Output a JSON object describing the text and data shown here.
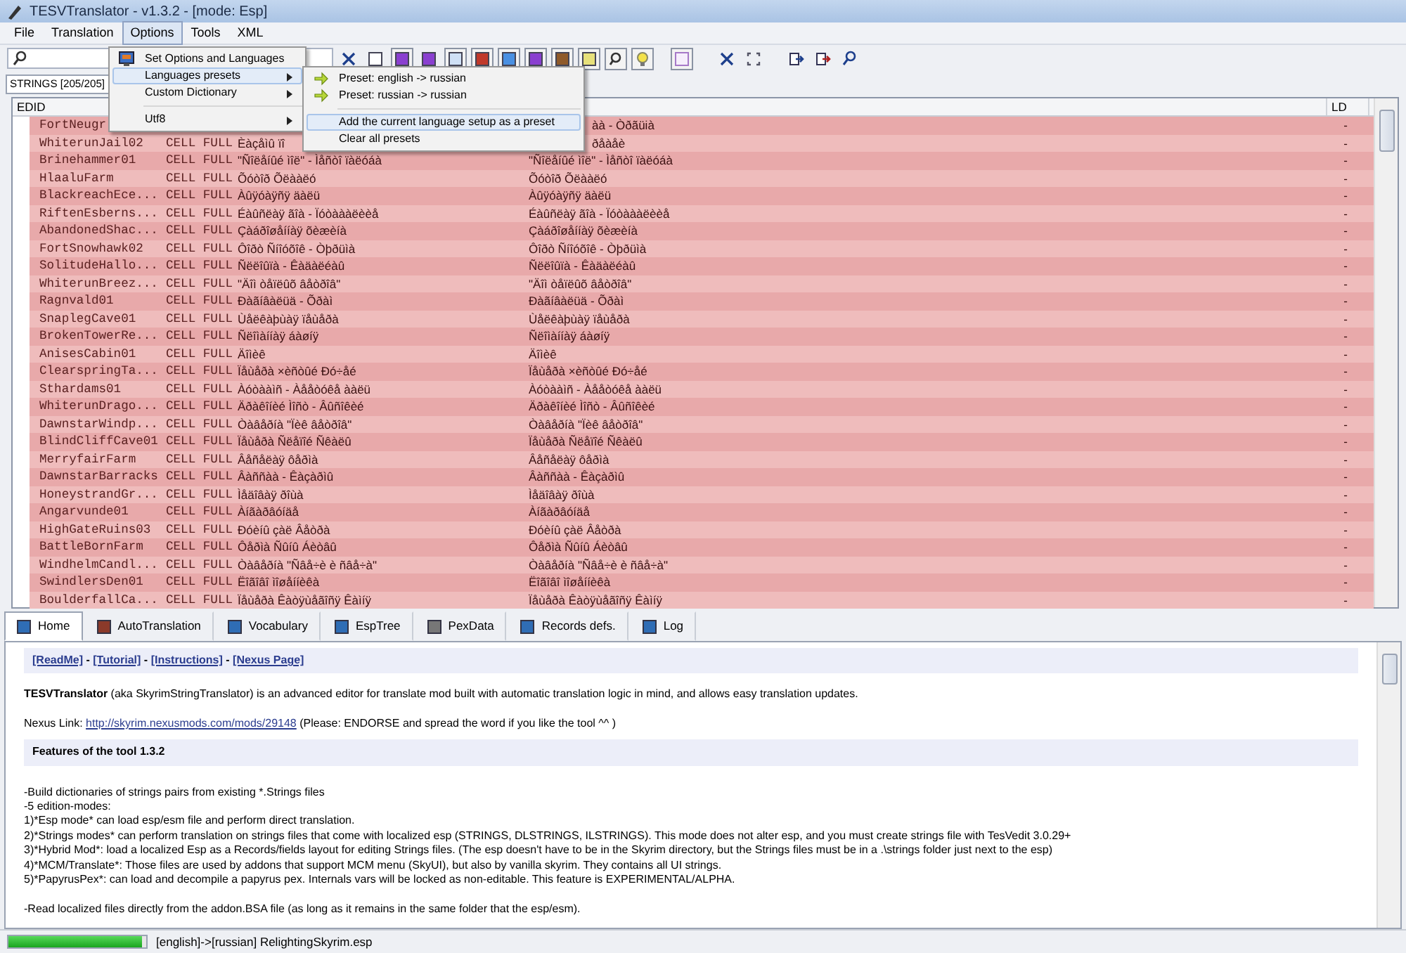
{
  "window": {
    "title": "TESVTranslator - v1.3.2 - [mode: Esp]"
  },
  "menu_bar": [
    {
      "label": "File",
      "selected": false
    },
    {
      "label": "Translation",
      "selected": false
    },
    {
      "label": "Options",
      "selected": true
    },
    {
      "label": "Tools",
      "selected": false
    },
    {
      "label": "XML",
      "selected": false
    }
  ],
  "options_menu": [
    {
      "label": "Set Options and Languages",
      "selected": false,
      "submenu": false
    },
    {
      "label": "Languages presets",
      "selected": true,
      "submenu": true
    },
    {
      "label": "Custom Dictionary",
      "selected": false,
      "submenu": true
    },
    {
      "label": "Utf8",
      "selected": false,
      "submenu": true
    }
  ],
  "presets_menu": [
    {
      "label": "Preset: english -> russian",
      "selected": false,
      "kind": "preset"
    },
    {
      "label": "Preset: russian -> russian",
      "selected": false,
      "kind": "preset"
    },
    {
      "label": "Add the current language setup as a preset",
      "selected": true,
      "kind": "action"
    },
    {
      "label": "Clear all presets",
      "selected": false,
      "kind": "action"
    }
  ],
  "strings_label": "STRINGS [205/205]",
  "table": {
    "columns": [
      "EDID",
      "LD"
    ],
    "rows": [
      {
        "kind": "covered",
        "edid": "FortNeugr",
        "dest": "àà - Òðãüià",
        "ld": "-"
      },
      {
        "kind": "covered",
        "edid": "WhiterunJail02",
        "type": "CELL FULL",
        "source": "Èàçåìû ïî",
        "dest": "ðåàåè",
        "ld": "-"
      },
      {
        "kind": "full",
        "edid": "Brinehammer01",
        "type": "CELL FULL",
        "source": "\"Ñîëåíûé ìîë\" - Ìåñòî ïàëóáà",
        "dest": "\"Ñîëåíûé ìîë\" - Ìåñòî ïàëóáà",
        "ld": "-"
      },
      {
        "kind": "full",
        "edid": "HlaaluFarm",
        "type": "CELL FULL",
        "source": "Õóòîð Õëààëó",
        "dest": "Õóòîð Õëààëó",
        "ld": "-"
      },
      {
        "kind": "full",
        "edid": "BlackreachEce...",
        "type": "CELL FULL",
        "source": "Àûÿóàÿñÿ äàëü",
        "dest": "Àûÿóàÿñÿ äàëü",
        "ld": "-"
      },
      {
        "kind": "full",
        "edid": "RiftenEsberns...",
        "type": "CELL FULL",
        "source": "Éàûñëàÿ ãîà - Ïóòàààëèèå",
        "dest": "Éàûñëàÿ ãîà - Ïóòàààëèèå",
        "ld": "-"
      },
      {
        "kind": "full",
        "edid": "AbandonedShac...",
        "type": "CELL FULL",
        "source": "Çàáðîøåííàÿ õèæèíà",
        "dest": "Çàáðîøåííàÿ õèæèíà",
        "ld": "-"
      },
      {
        "kind": "full",
        "edid": "FortSnowhawk02",
        "type": "CELL FULL",
        "source": "Ôîðò Ñíîóõîê - Òþðüìà",
        "dest": "Ôîðò Ñíîóõîê - Òþðüìà",
        "ld": "-"
      },
      {
        "kind": "full",
        "edid": "SolitudeHallo...",
        "type": "CELL FULL",
        "source": "Ñëëîûïà - Êàäàëéàû",
        "dest": "Ñëëîûïà - Êàäàëéàû",
        "ld": "-"
      },
      {
        "kind": "full",
        "edid": "WhiterunBreez...",
        "type": "CELL FULL",
        "source": "\"Äîì òåïëûõ âåòðîâ\"",
        "dest": "\"Äîì òåïëûõ âåòðîâ\"",
        "ld": "-"
      },
      {
        "kind": "full",
        "edid": "Ragnvald01",
        "type": "CELL FULL",
        "source": "Ðàãíâàëüä - Õðàì",
        "dest": "Ðàãíâàëüä - Õðàì",
        "ld": "-"
      },
      {
        "kind": "full",
        "edid": "SnaplegCave01",
        "type": "CELL FULL",
        "source": "Ùåëêàþùàÿ ïåùåðà",
        "dest": "Ùåëêàþùàÿ ïåùåðà",
        "ld": "-"
      },
      {
        "kind": "full",
        "edid": "BrokenTowerRe...",
        "type": "CELL FULL",
        "source": "Ñëîìàííàÿ áàøíÿ",
        "dest": "Ñëîìàííàÿ áàøíÿ",
        "ld": "-"
      },
      {
        "kind": "full",
        "edid": "AnisesCabin01",
        "type": "CELL FULL",
        "source": "Äîìèê",
        "dest": "Äîìèê",
        "ld": "-"
      },
      {
        "kind": "full",
        "edid": "ClearspringTa...",
        "type": "CELL FULL",
        "source": "Ïåùåðà ×èñòûé Ðó÷åé",
        "dest": "Ïåùåðà ×èñòûé Ðó÷åé",
        "ld": "-"
      },
      {
        "kind": "full",
        "edid": "Sthardams01",
        "type": "CELL FULL",
        "source": "Àóòààìñ - Àååòóêå ààëü",
        "dest": "Àóòààìñ - Àååòóêå ààëü",
        "ld": "-"
      },
      {
        "kind": "full",
        "edid": "WhiterunDrago...",
        "type": "CELL FULL",
        "source": "Äðàêîíèé Ìîñò - Âûñîêèé",
        "dest": "Äðàêîíèé Ìîñò - Âûñîêèé",
        "ld": "-"
      },
      {
        "kind": "full",
        "edid": "DawnstarWindp...",
        "type": "CELL FULL",
        "source": "Òàâåðíà \"Ïèê âåòðîâ\"",
        "dest": "Òàâåðíà \"Ïèê âåòðîâ\"",
        "ld": "-"
      },
      {
        "kind": "full",
        "edid": "BlindCliffCave01",
        "type": "CELL FULL",
        "source": "Ïåùåðà Ñëåïîé Ñêàëû",
        "dest": "Ïåùåðà Ñëåïîé Ñêàëû",
        "ld": "-"
      },
      {
        "kind": "full",
        "edid": "MerryfairFarm",
        "type": "CELL FULL",
        "source": "Âåñåëàÿ ôåðìà",
        "dest": "Âåñåëàÿ ôåðìà",
        "ld": "-"
      },
      {
        "kind": "full",
        "edid": "DawnstarBarracks",
        "type": "CELL FULL",
        "source": "Âàññàà - Êàçàðìû",
        "dest": "Âàññàà - Êàçàðìû",
        "ld": "-"
      },
      {
        "kind": "full",
        "edid": "HoneystrandGr...",
        "type": "CELL FULL",
        "source": "Ìåäîâàÿ ðîùà",
        "dest": "Ìåäîâàÿ ðîùà",
        "ld": "-"
      },
      {
        "kind": "full",
        "edid": "Angarvunde01",
        "type": "CELL FULL",
        "source": "Àíãàðâóíäå",
        "dest": "Àíãàðâóíäå",
        "ld": "-"
      },
      {
        "kind": "full",
        "edid": "HighGateRuins03",
        "type": "CELL FULL",
        "source": "Ðóèíû çàë Âåòðà",
        "dest": "Ðóèíû çàë Âåòðà",
        "ld": "-"
      },
      {
        "kind": "full",
        "edid": "BattleBornFarm",
        "type": "CELL FULL",
        "source": "Ôåðìà Ñûíû Áèòâû",
        "dest": "Ôåðìà Ñûíû Áèòâû",
        "ld": "-"
      },
      {
        "kind": "full",
        "edid": "WindhelmCandl...",
        "type": "CELL FULL",
        "source": "Òàâåðíà \"Ñâå÷è è ñâå÷à\"",
        "dest": "Òàâåðíà \"Ñâå÷è è ñâå÷à\"",
        "ld": "-"
      },
      {
        "kind": "full",
        "edid": "SwindlersDen01",
        "type": "CELL FULL",
        "source": "Ëîãîâî ìîøåííèêà",
        "dest": "Ëîãîâî ìîøåííèêà",
        "ld": "-"
      },
      {
        "kind": "full",
        "edid": "BoulderfallCa...",
        "type": "CELL FULL",
        "source": "Ïåùåðà Êàòÿùåãîñÿ Êàìíÿ",
        "dest": "Ïåùåðà Êàòÿùåãîñÿ Êàìíÿ",
        "ld": "-"
      }
    ]
  },
  "tabs": [
    {
      "label": "Home",
      "selected": true
    },
    {
      "label": "AutoTranslation",
      "selected": false
    },
    {
      "label": "Vocabulary",
      "selected": false
    },
    {
      "label": "EspTree",
      "selected": false
    },
    {
      "label": "PexData",
      "selected": false
    },
    {
      "label": "Records defs.",
      "selected": false
    },
    {
      "label": "Log",
      "selected": false
    }
  ],
  "home": {
    "links": [
      "[ReadMe]",
      "[Tutorial]",
      "[Instructions]",
      "[Nexus Page]"
    ],
    "link_separator": " - ",
    "intro": "**TESVTranslator** (aka SkyrimStringTranslator) is an advanced editor for translate mod built with automatic translation logic in mind, and allows easy translation updates.",
    "nexus_label": "Nexus Link:",
    "nexus_url": "http://skyrim.nexusmods.com/mods/29148",
    "nexus_note": "(Please: ENDORSE and spread the word if you like the tool ^^ )",
    "features_heading": "Features of the tool 1.3.2",
    "features": [
      "-Build dictionaries of strings pairs from existing *.Strings files",
      "-5 edition-modes:",
      "1)*Esp mode*  can load esp/esm file and perform direct translation.",
      "2)*Strings modes*  can perform translation on strings files that come with localized esp (STRINGS, DLSTRINGS, ILSTRINGS). This mode does not alter esp, and you must create strings file with TesVedit 3.0.29+",
      "3)*Hybrid Mod*: load a localized Esp as a Records/fields layout for editing Strings files. (The esp doesn't have to be in the Skyrim directory, but the Strings files must be in a .\\strings folder just next to the esp)",
      "4)*MCM/Translate*: Those files are used by addons that support MCM menu (SkyUI), but also by vanilla skyrim. They contains all UI strings.",
      "5)*PapyrusPex*: can load and decompile a papyrus pex. Internals vars will be locked as non-editable. This feature is EXPERIMENTAL/ALPHA."
    ],
    "features_more": [
      "-Read localized files directly from the addon.BSA file (as long as it remains in the same folder that the esp/esm)."
    ]
  },
  "status_bar": {
    "progress": {
      "level": 0.97
    },
    "text": "[english]->[russian] RelightingSkyrim.esp"
  }
}
